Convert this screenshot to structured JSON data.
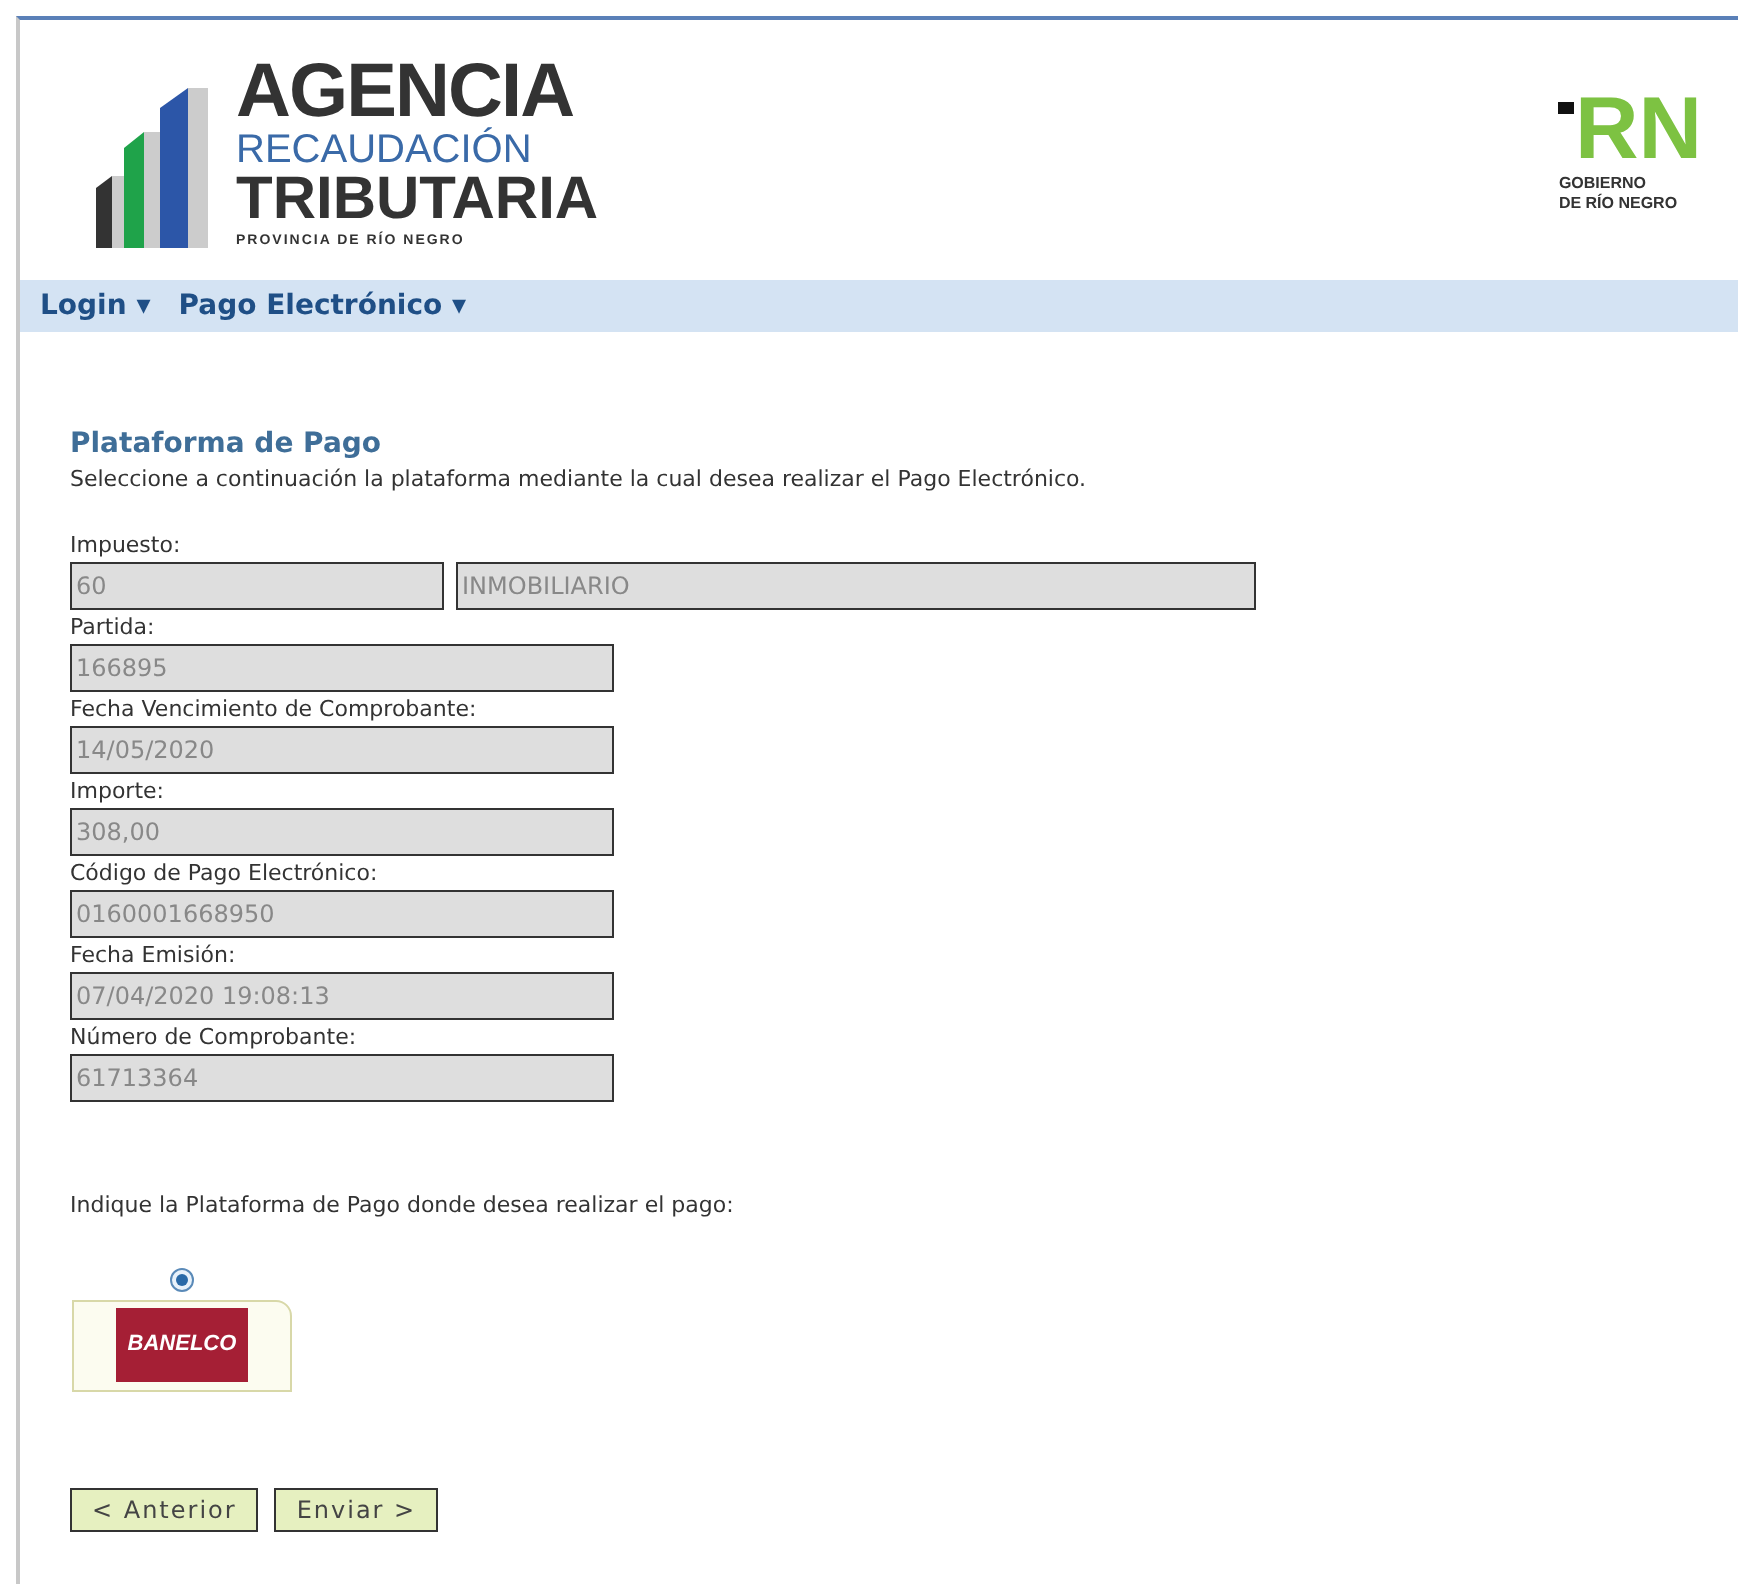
{
  "header": {
    "agency_logo": {
      "line_1": "AGENCIA",
      "line_2": "RECAUDACIÓN",
      "line_3": "TRIBUTARIA",
      "line_4": "PROVINCIA DE RÍO NEGRO"
    },
    "government_logo": {
      "mark": "RN",
      "line_1": "GOBIERNO",
      "line_2": "DE RÍO NEGRO"
    }
  },
  "nav": [
    {
      "label": "Login",
      "caret": "▾"
    },
    {
      "label": "Pago Electrónico",
      "caret": "▾"
    }
  ],
  "title": "Plataforma de Pago",
  "subtitle": "Seleccione a continuación la plataforma mediante la cual desea realizar el Pago Electrónico.",
  "fields": [
    {
      "label": "Impuesto:",
      "values": [
        "60",
        "INMOBILIARIO"
      ]
    },
    {
      "label": "Partida:",
      "values": [
        "166895"
      ]
    },
    {
      "label": "Fecha Vencimiento de Comprobante:",
      "values": [
        "14/05/2020"
      ]
    },
    {
      "label": "Importe:",
      "values": [
        "308,00"
      ]
    },
    {
      "label": "Código de Pago Electrónico:",
      "values": [
        "0160001668950"
      ]
    },
    {
      "label": "Fecha Emisión:",
      "values": [
        "07/04/2020 19:08:13"
      ]
    },
    {
      "label": "Número de Comprobante:",
      "values": [
        "61713364"
      ]
    }
  ],
  "platform_prompt": "Indique la Plataforma de Pago donde desea realizar el pago:",
  "platforms": [
    {
      "logo_text": "BANELCO",
      "selected": true
    }
  ],
  "buttons": [
    "< Anterior",
    "Enviar >"
  ]
}
